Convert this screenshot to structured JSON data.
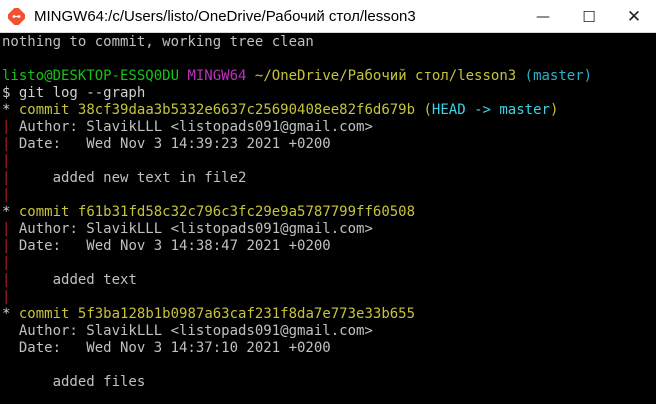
{
  "window": {
    "title": "MINGW64:/c/Users/listo/OneDrive/Рабочий стол/lesson3",
    "min_glyph": "—",
    "max_glyph": "☐",
    "close_glyph": "✕"
  },
  "colors": {
    "background": "#000000",
    "text": "#c0c0c0",
    "prompt_user": "#17c217",
    "prompt_env": "#bf2fbf",
    "prompt_path": "#c6c43a",
    "branch": "#2ab0c8",
    "commit_hash": "#c6c43a",
    "graph_bar": "#b51d1d"
  },
  "terminal": {
    "status_line": "nothing to commit, working tree clean",
    "prompt": {
      "user_host": "listo@DESKTOP-ESSQ0DU",
      "env": "MINGW64",
      "path": "~/OneDrive/Рабочий стол/lesson3",
      "branch": "(master)"
    },
    "command": "$ git log --graph",
    "graph_star": "*",
    "graph_bar": "|",
    "commits": [
      {
        "commit_label": "commit",
        "hash": "38cf39daa3b5332e6637c25690408ee82f6d679b",
        "ref_open": "(",
        "ref_head": "HEAD -> master",
        "ref_close": ")",
        "author": "Author: SlavikLLL <listopads091@gmail.com>",
        "date": "Date:   Wed Nov 3 14:39:23 2021 +0200",
        "message": "    added new text in file2"
      },
      {
        "commit_label": "commit",
        "hash": "f61b31fd58c32c796c3fc29e9a5787799ff60508",
        "author": "Author: SlavikLLL <listopads091@gmail.com>",
        "date": "Date:   Wed Nov 3 14:38:47 2021 +0200",
        "message": "    added text"
      },
      {
        "commit_label": "commit",
        "hash": "5f3ba128b1b0987a63caf231f8da7e773e33b655",
        "author": "Author: SlavikLLL <listopads091@gmail.com>",
        "date": "Date:   Wed Nov 3 14:37:10 2021 +0200",
        "message": "    added files"
      }
    ]
  }
}
